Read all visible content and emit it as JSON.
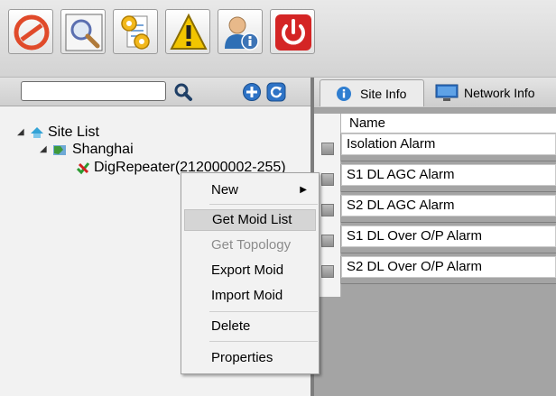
{
  "toolbar": {
    "buttons": [
      {
        "name": "no-entry-icon",
        "color": "#e04a2a"
      },
      {
        "name": "magnifier-icon",
        "color": "#5b6fb0"
      },
      {
        "name": "settings-document-icon",
        "color": "#d9a516"
      },
      {
        "name": "warning-icon",
        "color": "#f2c500"
      },
      {
        "name": "user-info-icon",
        "color": "#3d74b6"
      },
      {
        "name": "power-icon",
        "color": "#d42525"
      }
    ]
  },
  "left": {
    "search_value": "",
    "tree": {
      "root_label": "Site List",
      "site_label": "Shanghai",
      "device_label": "DigRepeater(212000002-255)"
    }
  },
  "right": {
    "tabs": [
      {
        "label": "Site Info",
        "active": true
      },
      {
        "label": "Network Info",
        "active": false
      }
    ],
    "table": {
      "header": "Name",
      "rows": [
        "Isolation Alarm",
        "S1 DL AGC Alarm",
        "S2 DL AGC Alarm",
        "S1 DL Over O/P Alarm",
        "S2 DL Over O/P Alarm"
      ]
    }
  },
  "context_menu": {
    "items": [
      "New",
      "Get Moid List",
      "Get Topology",
      "Export Moid",
      "Import Moid",
      "Delete",
      "Properties"
    ],
    "hovered": "Get Moid List",
    "disabled": [
      "Get Topology"
    ]
  }
}
